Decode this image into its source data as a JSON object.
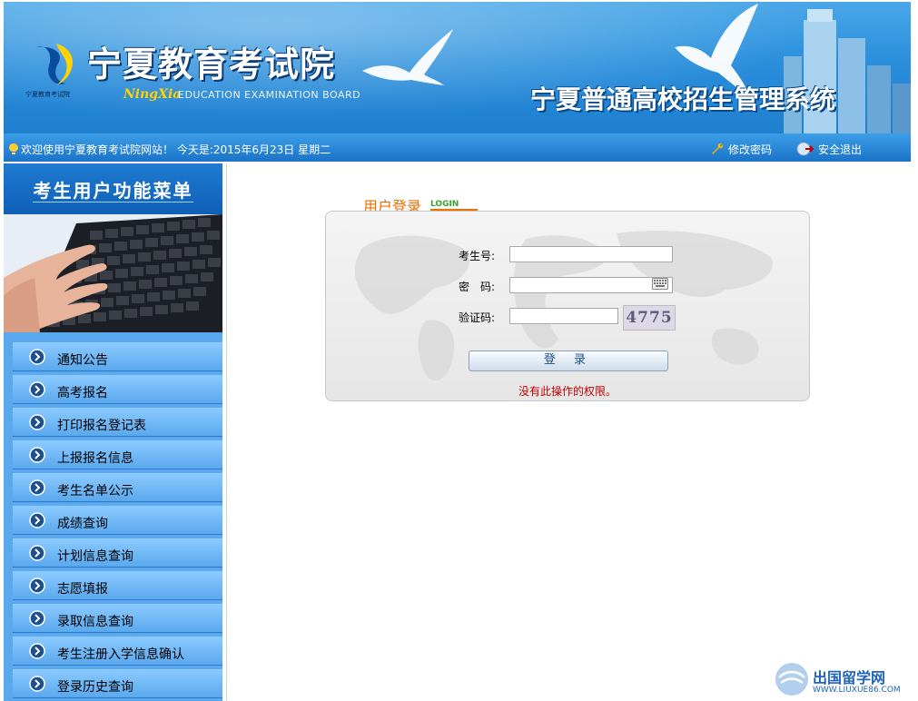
{
  "header": {
    "org_name": "宁夏教育考试院",
    "logo_small_text": "宁夏教育考试院",
    "ningxia_script": "NingXia",
    "org_english": "EDUCATION EXAMINATION BOARD",
    "system_title": "宁夏普通高校招生管理系统"
  },
  "navbar": {
    "welcome": "欢迎使用宁夏教育考试院网站！  今天是:2015年6月23日  星期二",
    "change_password": "修改密码",
    "logout": "安全退出"
  },
  "sidebar": {
    "title": "考生用户功能菜单",
    "items": [
      {
        "label": "通知公告"
      },
      {
        "label": "高考报名"
      },
      {
        "label": "打印报名登记表"
      },
      {
        "label": "上报报名信息"
      },
      {
        "label": "考生名单公示"
      },
      {
        "label": "成绩查询"
      },
      {
        "label": "计划信息查询"
      },
      {
        "label": "志愿填报"
      },
      {
        "label": "录取信息查询"
      },
      {
        "label": "考生注册入学信息确认"
      },
      {
        "label": "登录历史查询"
      }
    ]
  },
  "login": {
    "title": "用户登录",
    "title_tag": "LOGIN",
    "student_id_label": "考生号:",
    "student_id_value": "",
    "password_label": "密　码:",
    "password_value": "",
    "captcha_label": "验证码:",
    "captcha_value": "",
    "captcha_image_text": "4775",
    "submit_label": "登 录",
    "error_message": "没有此操作的权限。"
  },
  "watermark": {
    "name": "出国留学网",
    "url": "WWW.LIUXUE86.COM"
  },
  "colors": {
    "header_blue": "#2a8fdc",
    "sidebar_blue": "#5aa8ee",
    "accent_orange": "#f06d00",
    "error_red": "#c00000"
  }
}
